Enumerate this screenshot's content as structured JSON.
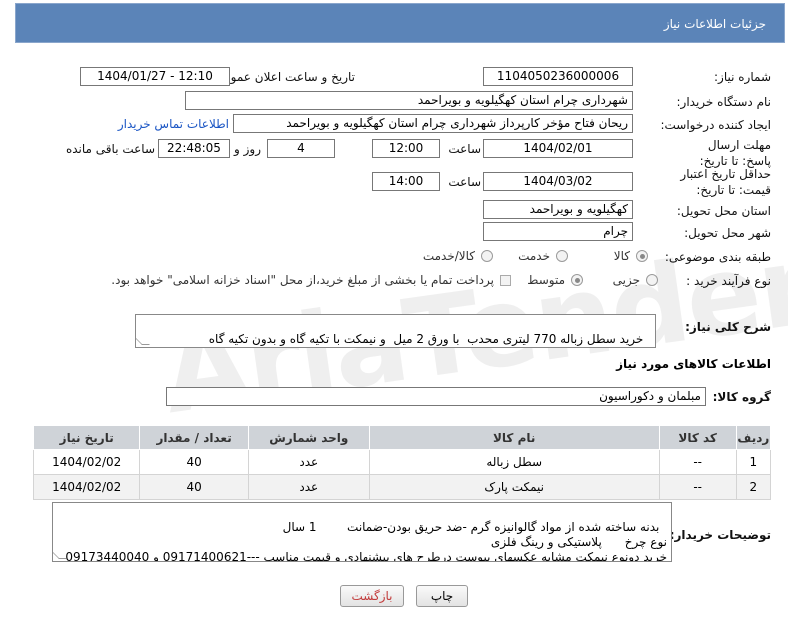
{
  "header": {
    "title": "جزئیات اطلاعات نیاز"
  },
  "fields": {
    "need_number_label": "شماره نیاز:",
    "need_number": "1104050236000006",
    "announce_label": "تاریخ و ساعت اعلان عمومی:",
    "announce_value": "1404/01/27 - 12:10",
    "buyer_org_label": "نام دستگاه خریدار:",
    "buyer_org": "شهرداری چرام استان کهگیلویه و بویراحمد",
    "creator_label": "ایجاد کننده درخواست:",
    "creator": "ریحان فتاح مؤخر کارپرداز شهرداری چرام استان کهگیلویه و بویراحمد",
    "contact_link": "اطلاعات تماس خریدار",
    "deadline_label": "مهلت ارسال پاسخ: تا تاریخ:",
    "deadline_date": "1404/02/01",
    "time_label": "ساعت",
    "deadline_time": "12:00",
    "days_value": "4",
    "days_label": "روز و",
    "remaining_time": "22:48:05",
    "remaining_label": "ساعت باقی مانده",
    "validity_label": "حداقل تاریخ اعتبار قیمت: تا تاریخ:",
    "validity_date": "1404/03/02",
    "validity_time": "14:00",
    "province_label": "استان محل تحویل:",
    "province": "کهگیلویه و بویراحمد",
    "city_label": "شهر محل تحویل:",
    "city": "چرام",
    "category_label": "طبقه بندی موضوعی:",
    "category_options": [
      "کالا",
      "خدمت",
      "کالا/خدمت"
    ],
    "process_label": "نوع فرآیند خرید :",
    "process_options": [
      "جزیی",
      "متوسط"
    ],
    "payment_note": "پرداخت تمام یا بخشی از مبلغ خرید،از محل \"اسناد خزانه اسلامی\" خواهد بود.",
    "desc_label": "شرح کلی نیاز:",
    "desc": "خرید سطل زباله 770 لیتری محدب  با ورق 2 میل  و نیمکت با تکیه گاه و بدون تکیه گاه"
  },
  "goods": {
    "section_title": "اطلاعات کالاهای مورد نیاز",
    "group_label": "گروه کالا:",
    "group_value": "مبلمان و دکوراسیون",
    "columns": [
      "ردیف",
      "کد کالا",
      "نام کالا",
      "واحد شمارش",
      "تعداد / مقدار",
      "تاریخ نیاز"
    ],
    "rows": [
      [
        "1",
        "--",
        "سطل زباله",
        "عدد",
        "40",
        "1404/02/02"
      ],
      [
        "2",
        "--",
        "نیمکت پارک",
        "عدد",
        "40",
        "1404/02/02"
      ]
    ]
  },
  "buyer_notes": {
    "label": "توضیحات خریدار:",
    "text": "بدنه ساخته شده از مواد گالوانیزه گرم -ضد حریق بودن-ضمانت        1 سال\nنوع چرخ      پلاستیکی و رینگ فلزی\nخرید دونوع نیمکت مشابه عکسهای پیوست درطرح های پیشنهادی و قیمت مناسب ---09171400621 و 09173440040"
  },
  "buttons": {
    "print": "چاپ",
    "back": "بازگشت"
  },
  "watermark": "AriaTender.net"
}
